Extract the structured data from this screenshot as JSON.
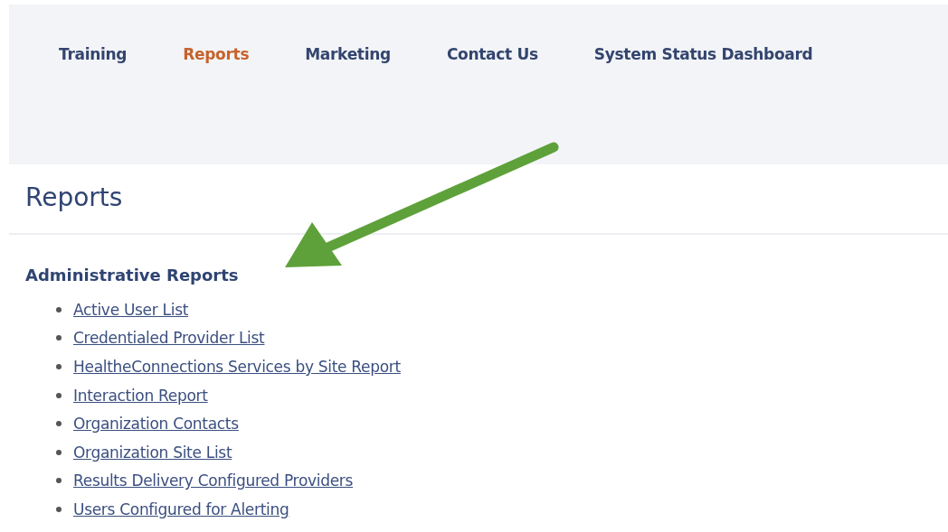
{
  "nav": [
    {
      "label": "Training",
      "selected": false
    },
    {
      "label": "Reports",
      "selected": true
    },
    {
      "label": "Marketing",
      "selected": false
    },
    {
      "label": "Contact Us",
      "selected": false
    },
    {
      "label": "System Status Dashboard",
      "selected": false
    }
  ],
  "page_title": "Reports",
  "section": {
    "title": "Administrative Reports",
    "links": [
      "Active User List",
      "Credentialed Provider List",
      "HealtheConnections Services by Site Report",
      "Interaction Report",
      "Organization Contacts",
      "Organization Site List",
      "Results Delivery Configured Providers",
      "Users Configured for Alerting"
    ]
  }
}
